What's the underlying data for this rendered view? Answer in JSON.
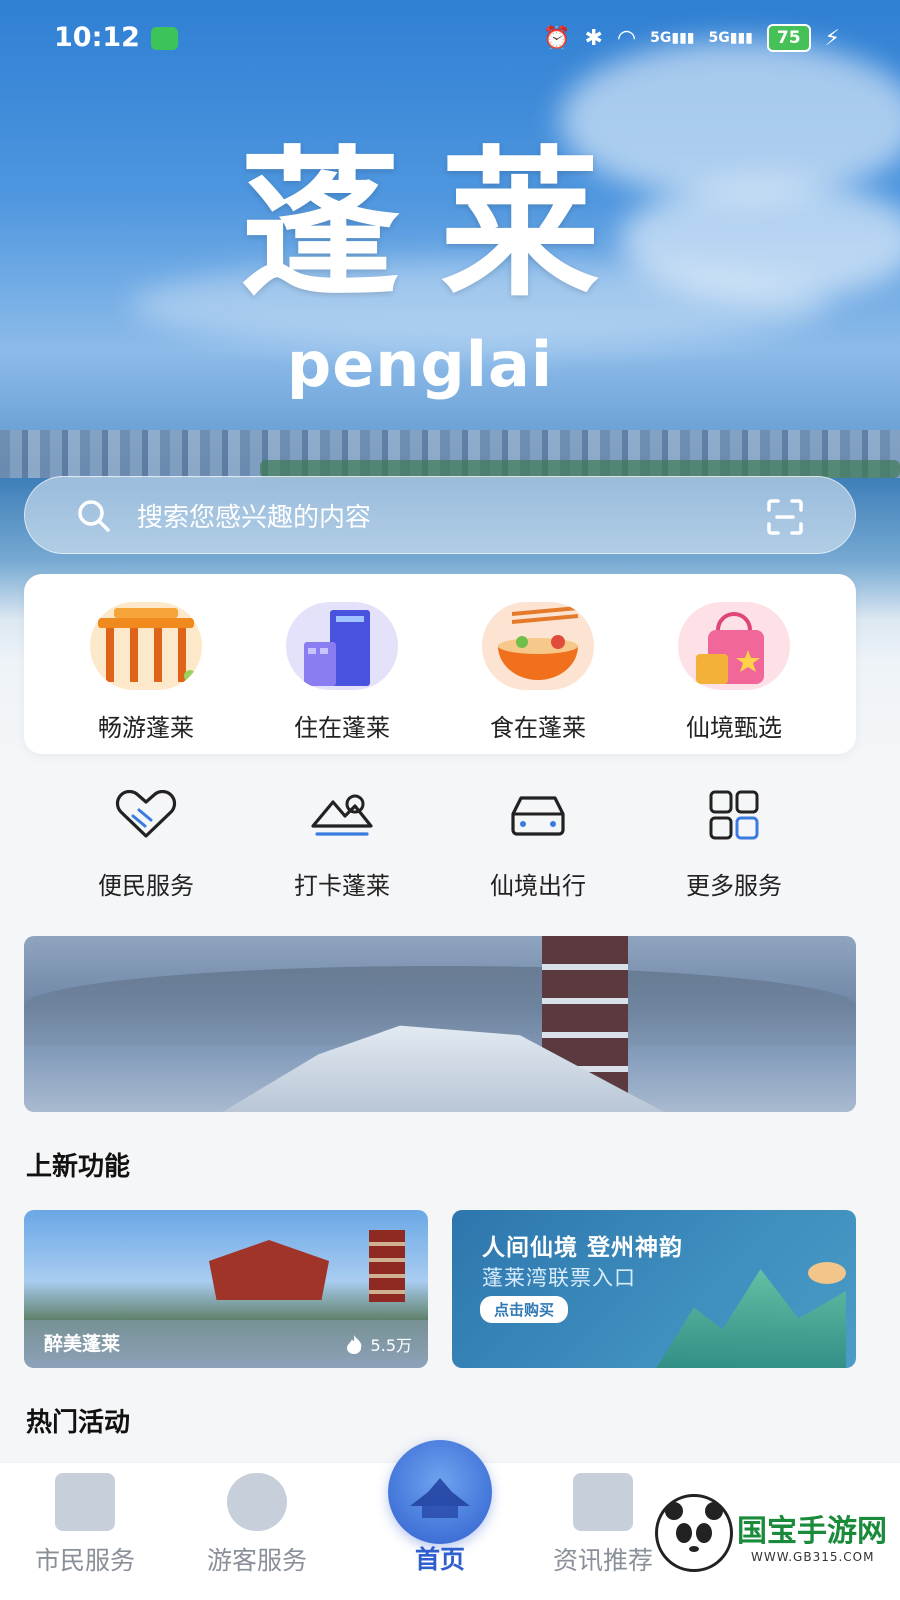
{
  "status_bar": {
    "time": "10:12",
    "signal1": "5G",
    "signal2": "5G",
    "battery": "75"
  },
  "hero": {
    "title": "蓬莱",
    "subtitle": "penglai"
  },
  "search": {
    "placeholder": "搜索您感兴趣的内容"
  },
  "categories": [
    {
      "label": "畅游蓬莱",
      "icon": "archway-icon"
    },
    {
      "label": "住在蓬莱",
      "icon": "building-icon"
    },
    {
      "label": "食在蓬莱",
      "icon": "noodle-bowl-icon"
    },
    {
      "label": "仙境甄选",
      "icon": "shopping-bag-icon"
    }
  ],
  "services": [
    {
      "label": "便民服务",
      "icon": "handshake-heart-icon"
    },
    {
      "label": "打卡蓬莱",
      "icon": "mountain-icon"
    },
    {
      "label": "仙境出行",
      "icon": "car-icon"
    },
    {
      "label": "更多服务",
      "icon": "grid-icon"
    }
  ],
  "sections": {
    "new_features": "上新功能",
    "hot_events": "热门活动"
  },
  "features": {
    "card1": {
      "caption": "醉美蓬莱",
      "views": "5.5万"
    },
    "card2": {
      "title": "人间仙境 登州神韵",
      "subtitle": "蓬莱湾联票入口",
      "button": "点击购买"
    }
  },
  "tabbar": {
    "tabs": [
      {
        "label": "市民服务"
      },
      {
        "label": "游客服务"
      },
      {
        "label": "首页"
      },
      {
        "label": "资讯推荐"
      }
    ]
  },
  "watermark": {
    "text": "国宝手游网",
    "url": "WWW.GB315.COM"
  },
  "colors": {
    "accent": "#2f5fcf",
    "brand_green": "#1a8a3b",
    "text": "#222222",
    "muted": "#8a9099"
  }
}
